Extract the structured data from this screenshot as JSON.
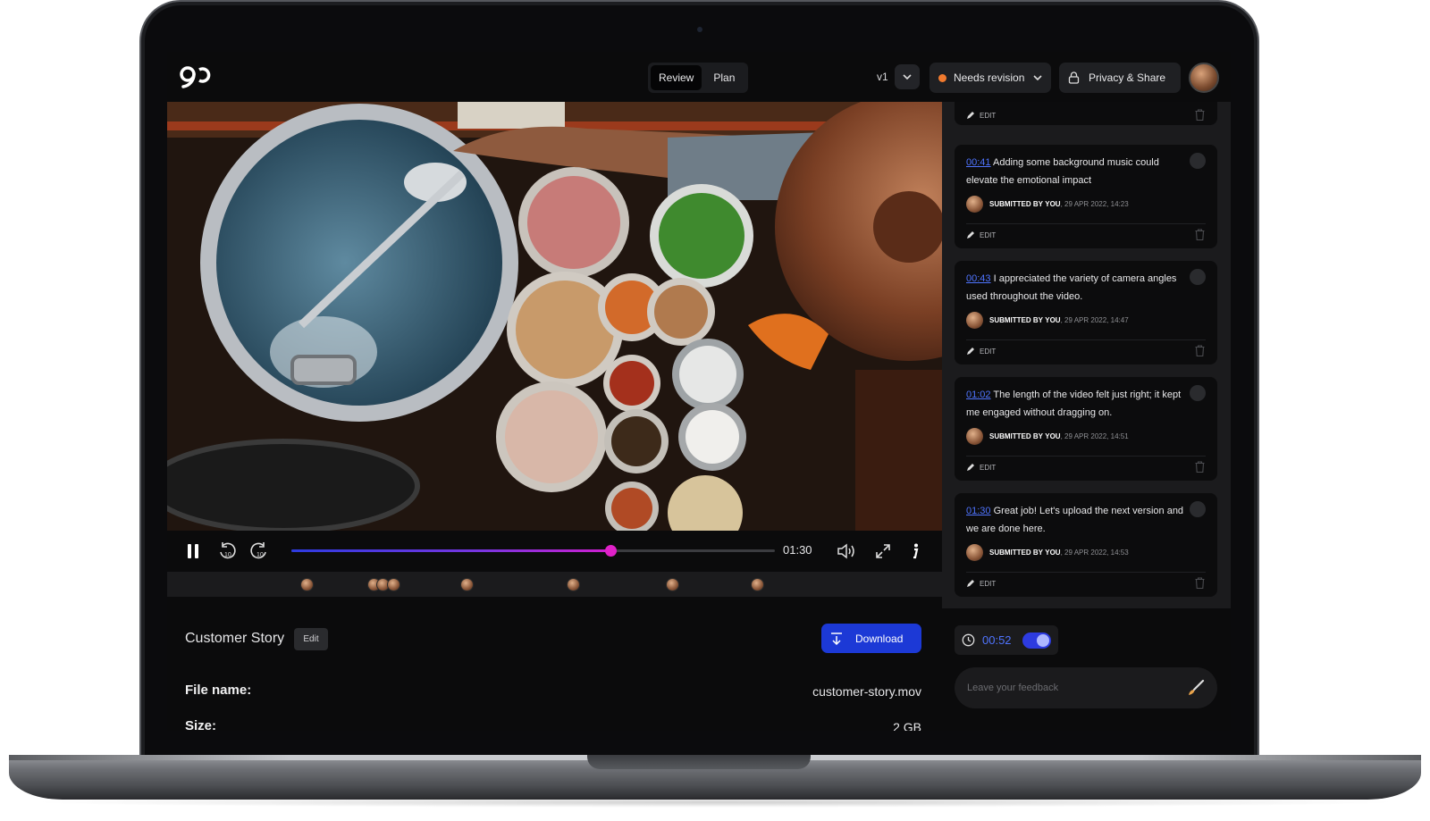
{
  "header": {
    "tabs": [
      {
        "label": "Review",
        "active": true
      },
      {
        "label": "Plan",
        "active": false
      }
    ],
    "version": "v1",
    "status": {
      "label": "Needs revision",
      "color": "#f07a2e"
    },
    "privacy_label": "Privacy & Share"
  },
  "player": {
    "time": "01:30",
    "progress": 0.66,
    "rewind_label": "10",
    "forward_label": "10"
  },
  "asset": {
    "title": "Customer Story",
    "edit_label": "Edit",
    "download_label": "Download",
    "file_name_label": "File name:",
    "file_name_value": "customer-story.mov",
    "size_label": "Size:",
    "size_value": "2 GB"
  },
  "comments": {
    "top_edit_label": "EDIT",
    "items": [
      {
        "time": "00:41",
        "text": "Adding some background music could elevate the emotional impact",
        "submitted_label": "SUBMITTED BY",
        "author": "YOU",
        "date": "29 APR 2022, 14:23",
        "edit_label": "EDIT"
      },
      {
        "time": "00:43",
        "text": "I appreciated the variety of camera angles used throughout the video.",
        "submitted_label": "SUBMITTED BY",
        "author": "YOU",
        "date": "29 APR 2022, 14:47",
        "edit_label": "EDIT"
      },
      {
        "time": "01:02",
        "text": "The length of the video felt just right; it kept me engaged without dragging on.",
        "submitted_label": "SUBMITTED BY",
        "author": "YOU",
        "date": "29 APR 2022, 14:51",
        "edit_label": "EDIT"
      },
      {
        "time": "01:30",
        "text": "Great job! Let's upload the next version and we are done here.",
        "submitted_label": "SUBMITTED BY",
        "author": "YOU",
        "date": "29 APR 2022, 14:53",
        "edit_label": "EDIT"
      }
    ]
  },
  "composer": {
    "timestamp": "00:52",
    "timestamp_enabled": true,
    "placeholder": "Leave your feedback"
  },
  "colors": {
    "accent": "#4f74ff",
    "download": "#1c39d6",
    "progress_knob": "#e021c8"
  }
}
